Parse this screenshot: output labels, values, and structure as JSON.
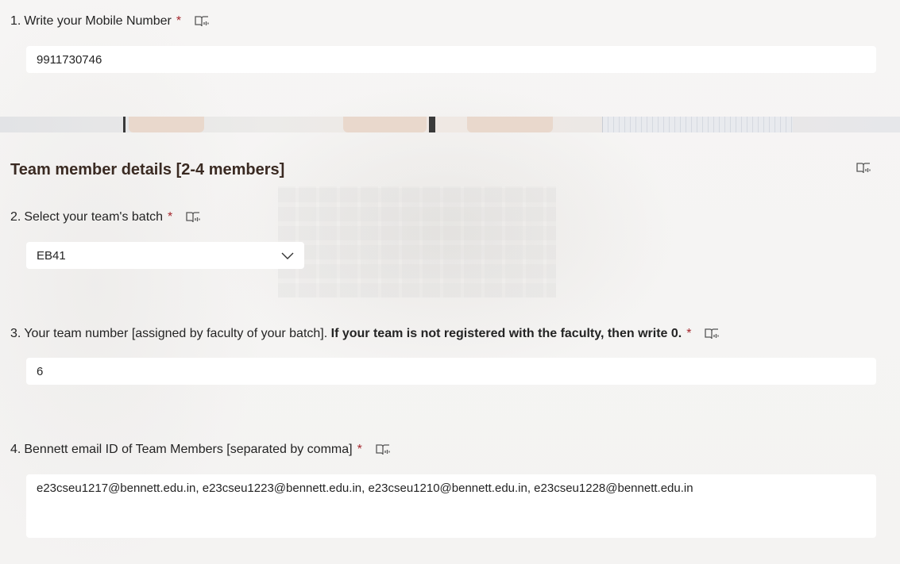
{
  "questions": {
    "q1": {
      "number": "1.",
      "label": "Write your Mobile Number",
      "required_mark": "*",
      "value": "9911730746"
    },
    "section": {
      "title": "Team member details [2-4 members]"
    },
    "q2": {
      "number": "2.",
      "label": "Select your team's batch",
      "required_mark": "*",
      "value": "EB41"
    },
    "q3": {
      "number": "3.",
      "label_plain": "Your team number [assigned by faculty of your batch]. ",
      "label_bold": "If your team is not registered with the faculty, then write 0.",
      "required_mark": "*",
      "value": "6"
    },
    "q4": {
      "number": "4.",
      "label": "Bennett email ID of Team Members [separated by comma]",
      "required_mark": "*",
      "value": "e23cseu1217@bennett.edu.in, e23cseu1223@bennett.edu.in, e23cseu1210@bennett.edu.in, e23cseu1228@bennett.edu.in"
    }
  },
  "icons": {
    "reader": "immersive-reader-icon",
    "dropdown": "chevron-down-icon"
  },
  "colors": {
    "required": "#a4262c",
    "section_title": "#3a2a22",
    "input_bg": "#ffffff"
  }
}
